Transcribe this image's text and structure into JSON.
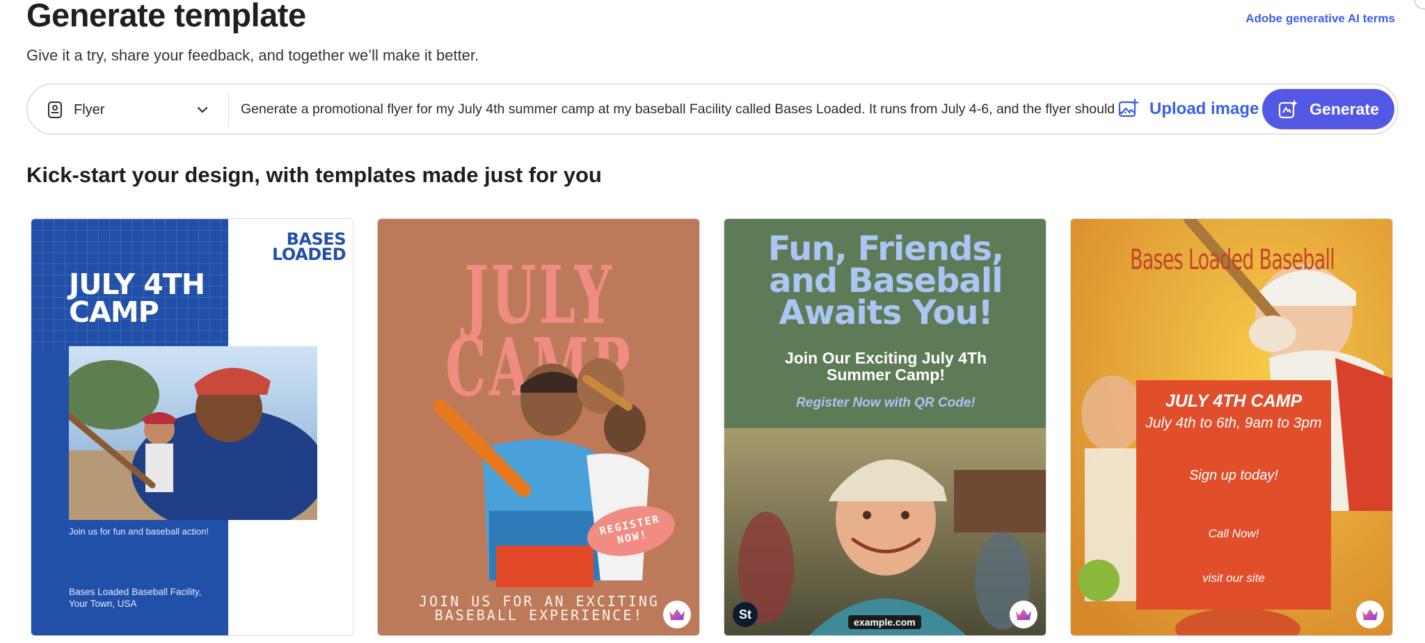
{
  "header": {
    "title": "Generate template",
    "subtitle": "Give it a try, share your feedback, and together we’ll make it better.",
    "terms_link": "Adobe generative AI terms"
  },
  "prompt_bar": {
    "type_value": "Flyer",
    "prompt_text": "Generate a promotional flyer for my July 4th summer camp at my baseball Facility called Bases Loaded. It runs from July 4-6, and the flyer should have a sign-up call to action",
    "upload_label": "Upload image",
    "generate_label": "Generate"
  },
  "section": {
    "title": "Kick-start your design, with templates made just for you"
  },
  "templates": [
    {
      "brand_line1": "BASES",
      "brand_line2": "LOADED",
      "headline_line1": "JULY 4TH",
      "headline_line2": "CAMP",
      "tagline": "Join us for fun and baseball action!",
      "address_line1": "Bases Loaded Baseball Facility,",
      "address_line2": "Your Town, USA"
    },
    {
      "headline_line1": "JULY",
      "headline_line2": "CAMP",
      "register_line1": "REGISTER",
      "register_line2": "NOW!",
      "footer_line1": "JOIN US FOR AN EXCITING",
      "footer_line2": "BASEBALL EXPERIENCE!"
    },
    {
      "headline_line1": "Fun, Friends,",
      "headline_line2": "and Baseball",
      "headline_line3": "Awaits You!",
      "sub_line1": "Join Our Exciting July 4Th",
      "sub_line2": "Summer Camp!",
      "register": "Register Now with QR Code!",
      "url": "example.com",
      "stock_badge": "St"
    },
    {
      "brand": "Bases Loaded Baseball",
      "camp": "JULY 4TH CAMP",
      "dates": "July 4th to 6th, 9am to 3pm",
      "signup": "Sign up today!",
      "call": "Call Now!",
      "visit": "visit our site"
    }
  ],
  "icons": {
    "flyer": "flyer-icon",
    "chevron": "chevron-down-icon",
    "upload": "upload-image-icon",
    "generate": "sparkle-generate-icon",
    "premium": "crown-icon"
  },
  "colors": {
    "accent": "#5258e4",
    "link": "#3b5ee6"
  }
}
